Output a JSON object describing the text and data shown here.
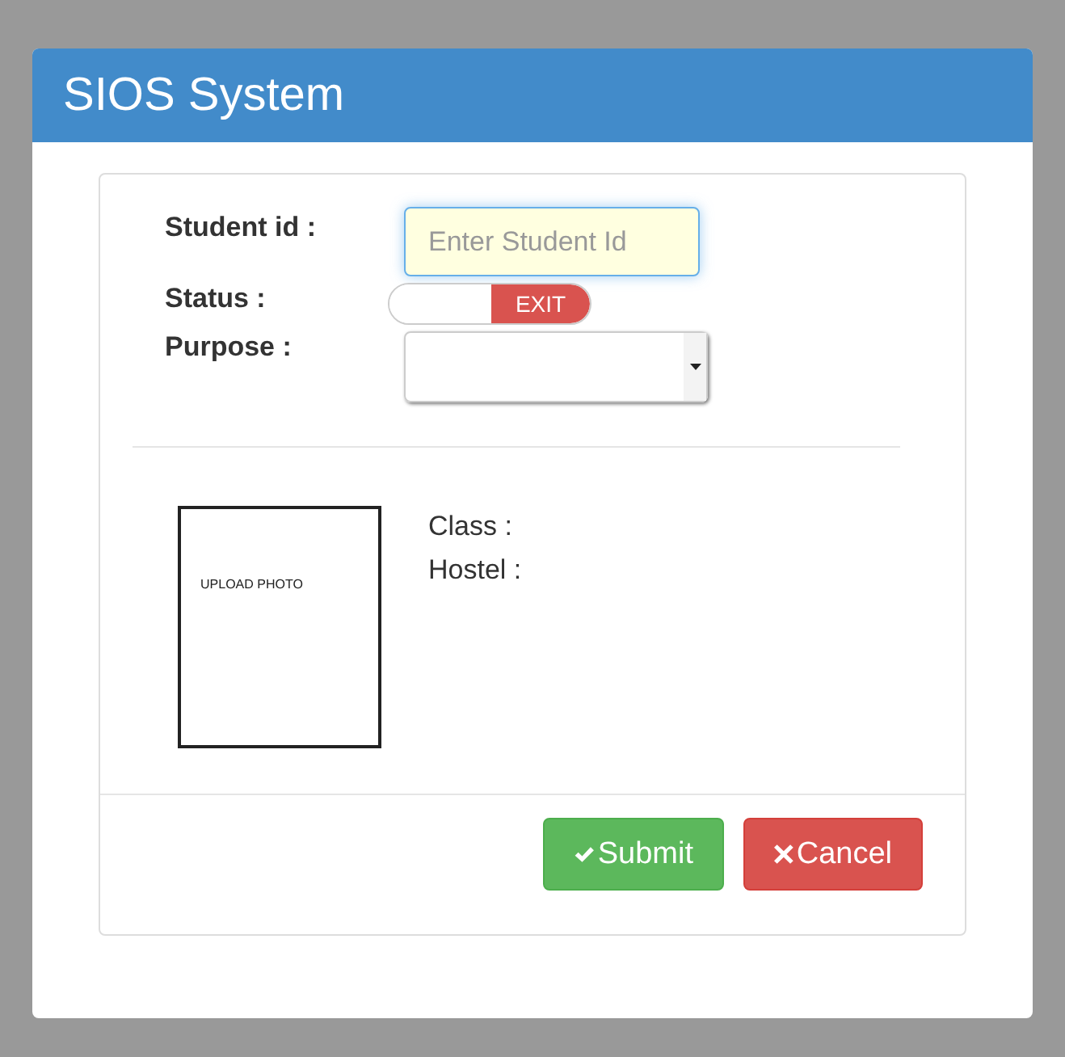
{
  "window": {
    "title": "SIOS System"
  },
  "form": {
    "student_id": {
      "label": "Student id :",
      "placeholder": "Enter Student Id",
      "focused": true
    },
    "status": {
      "label": "Status :",
      "switch_label": "EXIT",
      "on": false
    },
    "purpose": {
      "label": "Purpose :"
    }
  },
  "photo": {
    "label": "UPLOAD PHOTO"
  },
  "details": [
    "Class :",
    "Hostel :"
  ],
  "buttons": [
    {
      "kind": "submit",
      "label": "Submit"
    },
    {
      "kind": "cancel",
      "label": "Cancel"
    }
  ]
}
